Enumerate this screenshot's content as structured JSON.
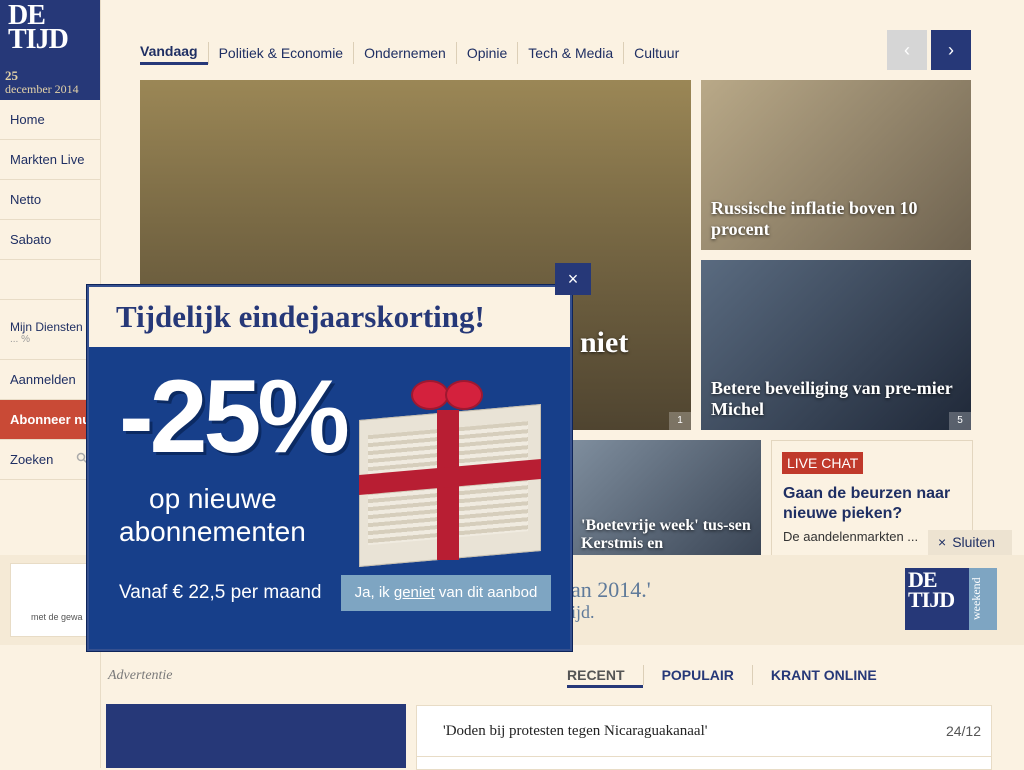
{
  "logo": {
    "line1": "DE",
    "line2": "TIJD",
    "day": "25",
    "month_year": "december 2014"
  },
  "sidebar": {
    "items": [
      {
        "label": "Home"
      },
      {
        "label": "Markten Live"
      },
      {
        "label": "Netto"
      },
      {
        "label": "Sabato"
      }
    ],
    "diensten": {
      "label": "Mijn Diensten",
      "sub": "... %"
    },
    "aanmelden": "Aanmelden",
    "abonneer": "Abonneer nu",
    "zoeken": "Zoeken"
  },
  "tabs": [
    "Vandaag",
    "Politiek & Economie",
    "Ondernemen",
    "Opinie",
    "Tech & Media",
    "Cultuur"
  ],
  "arrows": {
    "prev": "‹",
    "next": "›"
  },
  "stories": {
    "main": {
      "headline": "niet",
      "count": "1"
    },
    "russia": {
      "headline": "Russische inflatie boven 10 procent"
    },
    "michel": {
      "headline": "Betere beveiliging van pre-mier Michel",
      "count": "5"
    },
    "boete": {
      "headline": "'Boetevrije week' tus-sen Kerstmis en"
    }
  },
  "livechat": {
    "badge": "LIVE CHAT",
    "question": "Gaan de beurzen naar nieuwe pieken?",
    "sub": "De aandelenmarkten ...",
    "sluiten": "Sluiten"
  },
  "weekend": {
    "small_text": "met de gewa",
    "quote": "an 2014.'",
    "source": "ijd.",
    "logo_line1": "DE",
    "logo_line2": "TIJD",
    "logo_vert": "weekend"
  },
  "lower": {
    "advertentie": "Advertentie",
    "tabs": [
      "RECENT",
      "POPULAIR",
      "KRANT ONLINE"
    ],
    "recent_item": "'Doden bij protesten tegen Nicaraguakanaal'",
    "recent_date": "24/12"
  },
  "popup": {
    "title": "Tijdelijk eindejaarskorting!",
    "discount": "-25%",
    "line1": "op nieuwe",
    "line2": "abonnementen",
    "price": "Vanaf € 22,5 per maand",
    "cta_pre": "Ja, ik ",
    "cta_u": "geniet",
    "cta_post": " van dit aanbod",
    "close": "×"
  }
}
